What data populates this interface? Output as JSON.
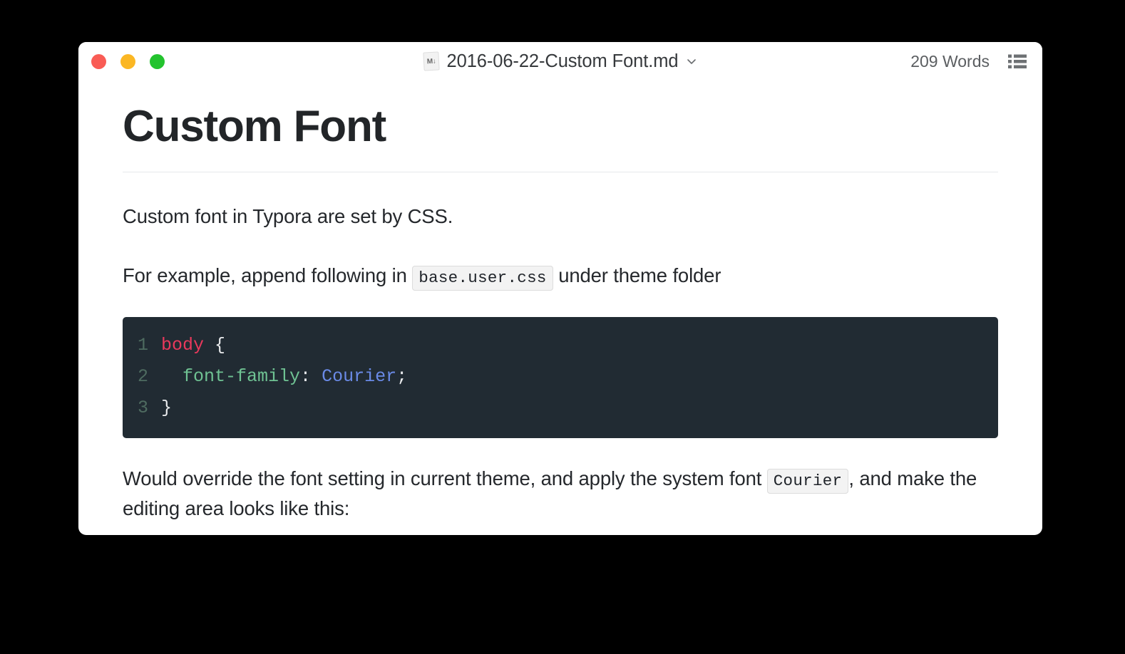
{
  "window": {
    "traffic_lights": [
      {
        "name": "close",
        "color": "#f95c55"
      },
      {
        "name": "minimize",
        "color": "#fbb724"
      },
      {
        "name": "zoom",
        "color": "#23c32e"
      }
    ],
    "title": "2016-06-22-Custom Font.md",
    "file_icon_label": "M↓",
    "chevron_icon": "chevron-down-icon",
    "word_count": "209 Words",
    "outline_icon": "outline-list-icon"
  },
  "document": {
    "heading": "Custom Font",
    "paragraph_1": "Custom font in Typora are set by CSS.",
    "paragraph_2": {
      "before": "For example, append following in ",
      "code": "base.user.css",
      "after": " under theme folder"
    },
    "code_block": {
      "language": "css",
      "lines": [
        {
          "number": "1",
          "tokens": [
            {
              "text": "body",
              "type": "selector"
            },
            {
              "text": " ",
              "type": "plain"
            },
            {
              "text": "{",
              "type": "punctuation"
            }
          ]
        },
        {
          "number": "2",
          "tokens": [
            {
              "text": "  ",
              "type": "plain"
            },
            {
              "text": "font-family",
              "type": "property"
            },
            {
              "text": ": ",
              "type": "punctuation"
            },
            {
              "text": "Courier",
              "type": "value"
            },
            {
              "text": ";",
              "type": "punctuation"
            }
          ]
        },
        {
          "number": "3",
          "tokens": [
            {
              "text": "}",
              "type": "punctuation"
            }
          ]
        }
      ],
      "line_1_plain": "body {",
      "line_2_plain": "  font-family: Courier;",
      "line_3_plain": "}"
    },
    "paragraph_3": {
      "before": "Would override the font setting in current theme, and apply the system font ",
      "code": "Courier",
      "after": ", and make the editing area looks like this:"
    }
  },
  "colors": {
    "page_background": "#000000",
    "window_background": "#ffffff",
    "code_background": "#212b33",
    "code_selector": "#e8395c",
    "code_property": "#6fc293",
    "code_value": "#6a8ae6",
    "code_linenumber": "#4e6b60",
    "inline_code_background": "#f3f3f3",
    "text": "#25282c",
    "rule": "#e6e8ea"
  }
}
